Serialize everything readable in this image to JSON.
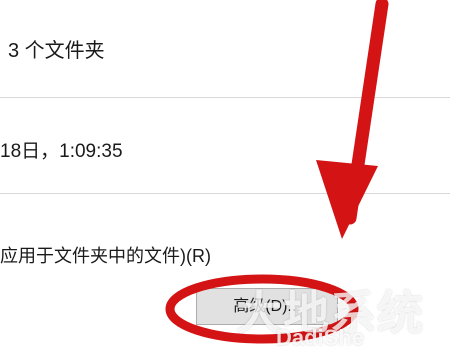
{
  "properties": {
    "contains_value": "3 个文件夹",
    "created_value": "18日，1:09:35",
    "attributes_apply_text": "应用于文件夹中的文件)(R)",
    "advanced_button_label": "高级(D)..."
  },
  "watermark": {
    "text": "大地系统",
    "subtext": "DadiShe"
  },
  "annotation": {
    "arrow_color": "#d41414",
    "ellipse_color": "#d41414"
  }
}
